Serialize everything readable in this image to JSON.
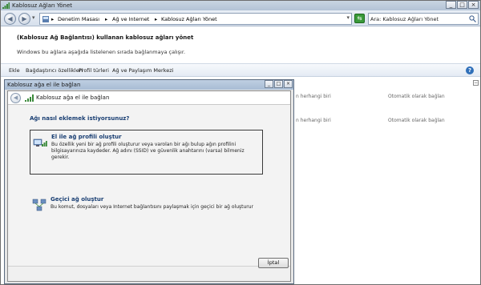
{
  "window": {
    "title": "Kablosuz Ağları Yönet",
    "minimize": "_",
    "maximize": "□",
    "close": "×"
  },
  "address": {
    "crumbs": [
      "Denetim Masası",
      "Ağ ve Internet",
      "Kablosuz Ağları Yönet"
    ],
    "separator": "▸",
    "search_placeholder": "Ara: Kablosuz Ağları Yönet"
  },
  "main": {
    "heading": "(Kablosuz Ağ Bağlantısı) kullanan kablosuz ağları yönet",
    "subtext": "Windows bu ağlara aşağıda listelenen sırada bağlanmaya çalışır."
  },
  "toolbar": {
    "items": [
      "Ekle",
      "Bağdaştırıcı özellikleri",
      "Profil türleri",
      "Ağ ve Paylaşım Merkezi"
    ],
    "help": "?"
  },
  "background_rows": [
    {
      "security": "n herhangi biri",
      "mode": "Otomatik olarak bağlan"
    },
    {
      "security": "n herhangi biri",
      "mode": "Otomatik olarak bağlan"
    }
  ],
  "dialog": {
    "title": "Kablosuz ağa el ile bağlan",
    "header": "Kablosuz ağa el ile bağlan",
    "question": "Ağı nasıl eklemek istiyorsunuz?",
    "options": [
      {
        "title": "El ile ağ profili oluştur",
        "description": "Bu özellik yeni bir ağ profili oluşturur veya varolan bir ağı bulup ağın profilini bilgisayarınıza kaydeder. Ağ adını (SSID) ve güvenlik anahtarını (varsa) bilmeniz gerekir.",
        "icon": "network-profile-icon"
      },
      {
        "title": "Geçici ağ oluştur",
        "description": "Bu komut, dosyaları veya Internet bağlantısını paylaşmak için geçici bir ağ oluşturur",
        "icon": "adhoc-network-icon"
      }
    ],
    "cancel": "İptal"
  },
  "colors": {
    "title_bar": "#b3c3d6",
    "link_blue": "#1a3f73",
    "dialog_bg": "#f3f3f3"
  }
}
